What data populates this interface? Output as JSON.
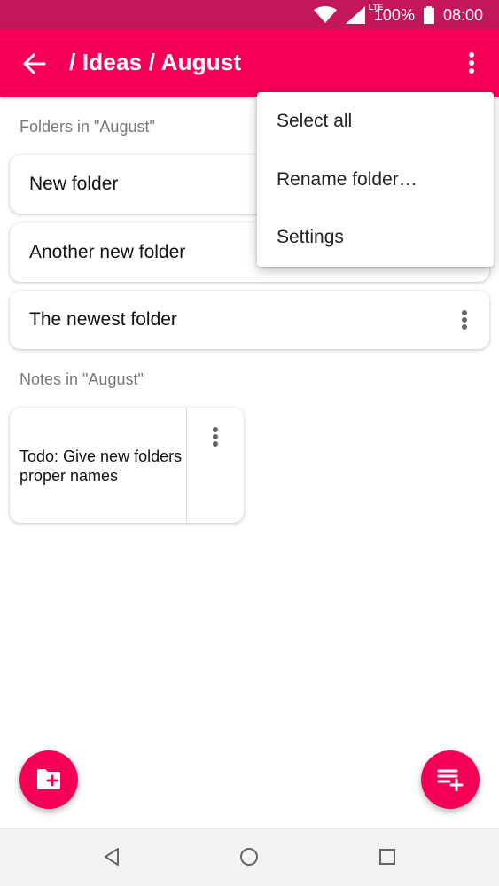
{
  "status_bar": {
    "network_label": "LTE",
    "battery": "100%",
    "time": "08:00",
    "icons": [
      "wifi-icon",
      "signal-icon",
      "battery-icon"
    ]
  },
  "app_bar": {
    "title": "/ Ideas / August",
    "icons": [
      "back-arrow-icon",
      "more-vert-icon"
    ],
    "color": "#f50057",
    "status_color": "#c2185b"
  },
  "folders_section": {
    "heading": "Folders in \"August\"",
    "items": [
      {
        "label": "New folder"
      },
      {
        "label": "Another new folder"
      },
      {
        "label": "The newest folder"
      }
    ]
  },
  "notes_section": {
    "heading": "Notes in \"August\"",
    "items": [
      {
        "text": "Todo: Give new folders proper names"
      }
    ]
  },
  "overflow_menu": {
    "items": [
      {
        "label": "Select all"
      },
      {
        "label": "Rename folder…"
      },
      {
        "label": "Settings"
      }
    ]
  },
  "fabs": {
    "left_icon": "new-folder-icon",
    "right_icon": "new-note-icon",
    "color": "#f50057"
  },
  "nav_bar": {
    "icons": [
      "nav-back-icon",
      "nav-home-icon",
      "nav-recents-icon"
    ]
  }
}
